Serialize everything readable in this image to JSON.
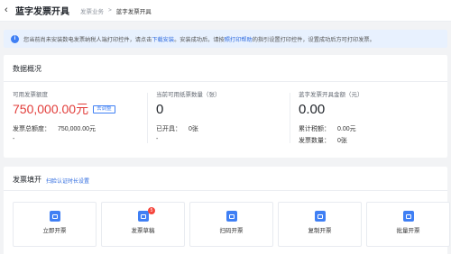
{
  "header": {
    "back_icon": "chevron-left-icon",
    "title": "蓝字发票开具",
    "breadcrumb": [
      "发票业务",
      "蓝字发票开具"
    ]
  },
  "notice": {
    "text_1": "您当前尚未安装数电发票纳税人端打印控件，请点击",
    "link_1": "下载安装",
    "text_2": "。安装成功后，请按",
    "link_2": "照打印帮助",
    "text_3": "的指引设置打印控件，设置成功后方可打印发票。",
    "icon": "info-icon"
  },
  "overview": {
    "title": "数据概况",
    "col1": {
      "label": "可用发票额度",
      "value": "750,000.00元",
      "adjust_btn": "去调整",
      "total_label": "发票总额度：",
      "total_value": "750,000.00元",
      "extra": "-"
    },
    "col2": {
      "label": "当前可用纸票数量（张）",
      "value": "0",
      "issued_label": "已开具：",
      "issued_value": "0张",
      "extra": "-"
    },
    "col3": {
      "label": "蓝字发票开具金额（元）",
      "value": "0.00",
      "tax_label": "累计税额：",
      "tax_value": "0.00元",
      "count_label": "发票数量：",
      "count_value": "0张"
    }
  },
  "fill": {
    "title": "发票填开",
    "tip_link": "扫脸认证时长设置",
    "cards": [
      {
        "label": "立即开票",
        "icon": "invoice-icon"
      },
      {
        "label": "发票草稿",
        "icon": "draft-icon",
        "badge": "5"
      },
      {
        "label": "扫码开票",
        "icon": "qr-scan-icon"
      },
      {
        "label": "复制开票",
        "icon": "copy-icon"
      },
      {
        "label": "批量开票",
        "icon": "batch-icon"
      }
    ]
  },
  "colors": {
    "primary": "#3f7ff4",
    "danger": "#e23d3a",
    "notice_bg": "#e8f1fe"
  }
}
